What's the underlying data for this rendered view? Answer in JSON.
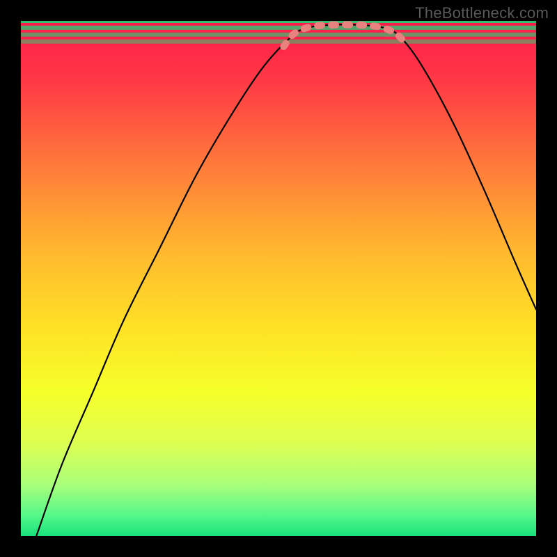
{
  "watermark": "TheBottleneck.com",
  "chart_data": {
    "type": "line",
    "title": "",
    "xlabel": "",
    "ylabel": "",
    "xlim": [
      0,
      100
    ],
    "ylim": [
      0,
      100
    ],
    "grid": false,
    "legend": false,
    "gradient_stops": [
      {
        "offset": 0,
        "color": "#ff1a4b"
      },
      {
        "offset": 0.12,
        "color": "#ff3a45"
      },
      {
        "offset": 0.28,
        "color": "#ff7a3a"
      },
      {
        "offset": 0.45,
        "color": "#ffb92e"
      },
      {
        "offset": 0.6,
        "color": "#ffe326"
      },
      {
        "offset": 0.72,
        "color": "#f6ff2a"
      },
      {
        "offset": 0.82,
        "color": "#ddff52"
      },
      {
        "offset": 0.9,
        "color": "#aaff7a"
      },
      {
        "offset": 0.96,
        "color": "#55f88a"
      },
      {
        "offset": 1.0,
        "color": "#18e27c"
      }
    ],
    "green_band": {
      "y_from": 96,
      "y_to": 100
    },
    "series": [
      {
        "name": "bottleneck-curve",
        "color": "#000000",
        "points": [
          {
            "x": 3,
            "y": 0
          },
          {
            "x": 8,
            "y": 14
          },
          {
            "x": 14,
            "y": 28
          },
          {
            "x": 20,
            "y": 42
          },
          {
            "x": 27,
            "y": 56
          },
          {
            "x": 34,
            "y": 70
          },
          {
            "x": 41,
            "y": 82
          },
          {
            "x": 47,
            "y": 91
          },
          {
            "x": 52,
            "y": 96.5
          },
          {
            "x": 55,
            "y": 98.5
          },
          {
            "x": 60,
            "y": 99.2
          },
          {
            "x": 66,
            "y": 99.2
          },
          {
            "x": 71,
            "y": 98.5
          },
          {
            "x": 74,
            "y": 96.5
          },
          {
            "x": 78,
            "y": 91
          },
          {
            "x": 84,
            "y": 80
          },
          {
            "x": 90,
            "y": 67
          },
          {
            "x": 96,
            "y": 53
          },
          {
            "x": 100,
            "y": 44
          }
        ]
      },
      {
        "name": "highlight-band",
        "color": "#e8827e",
        "points": [
          {
            "x": 51,
            "y": 95
          },
          {
            "x": 53,
            "y": 97.5
          },
          {
            "x": 56,
            "y": 98.8
          },
          {
            "x": 60,
            "y": 99.2
          },
          {
            "x": 66,
            "y": 99.2
          },
          {
            "x": 70,
            "y": 98.7
          },
          {
            "x": 73,
            "y": 97.4
          },
          {
            "x": 75,
            "y": 95
          }
        ]
      }
    ]
  }
}
